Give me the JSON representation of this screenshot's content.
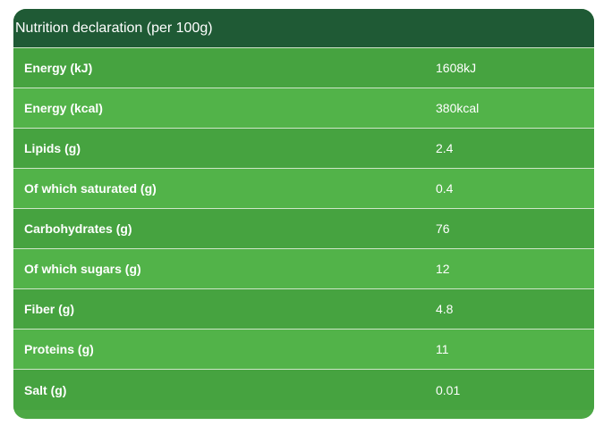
{
  "table": {
    "title": "Nutrition declaration (per 100g)",
    "rows": [
      {
        "label": "Energy (kJ)",
        "value": "1608kJ"
      },
      {
        "label": "Energy (kcal)",
        "value": "380kcal"
      },
      {
        "label": "Lipids (g)",
        "value": "2.4"
      },
      {
        "label": "Of which saturated (g)",
        "value": "0.4"
      },
      {
        "label": "Carbohydrates (g)",
        "value": "76"
      },
      {
        "label": "Of which sugars (g)",
        "value": "12"
      },
      {
        "label": "Fiber (g)",
        "value": "4.8"
      },
      {
        "label": "Proteins (g)",
        "value": "11"
      },
      {
        "label": "Salt (g)",
        "value": "0.01"
      }
    ]
  },
  "colors": {
    "header_bg": "#1f5a35",
    "row_odd": "#46a340",
    "row_even": "#52b349",
    "text": "#ffffff"
  }
}
